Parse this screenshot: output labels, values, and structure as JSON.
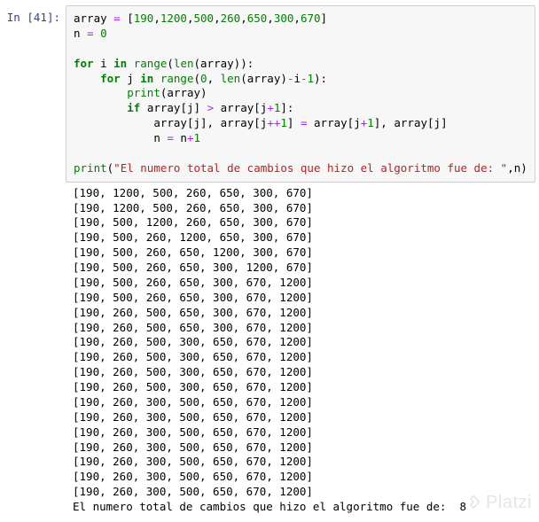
{
  "cell": {
    "prompt_prefix": "In [",
    "prompt_number": "41",
    "prompt_suffix": "]:",
    "code": {
      "l1_array": "array",
      "l1_eq": " = ",
      "l1_open": "[",
      "l1_n1": "190",
      "l1_c1": ",",
      "l1_n2": "1200",
      "l1_c2": ",",
      "l1_n3": "500",
      "l1_c3": ",",
      "l1_n4": "260",
      "l1_c4": ",",
      "l1_n5": "650",
      "l1_c5": ",",
      "l1_n6": "300",
      "l1_c6": ",",
      "l1_n7": "670",
      "l1_close": "]",
      "l2_n": "n",
      "l2_eq": " = ",
      "l2_zero": "0",
      "l4_for": "for",
      "l4_i": " i ",
      "l4_in": "in",
      "l4_sp": " ",
      "l4_range": "range",
      "l4_open": "(",
      "l4_len": "len",
      "l4_open2": "(",
      "l4_arr": "array",
      "l4_close2": ")",
      "l4_close": "):",
      "l5_indent": "    ",
      "l5_for": "for",
      "l5_j": " j ",
      "l5_in": "in",
      "l5_sp": " ",
      "l5_range": "range",
      "l5_open": "(",
      "l5_zero": "0",
      "l5_comma": ", ",
      "l5_len": "len",
      "l5_open2": "(",
      "l5_arr": "array",
      "l5_close2": ")",
      "l5_minus": "-",
      "l5_i": "i",
      "l5_m1": "-",
      "l5_one": "1",
      "l5_close": "):",
      "l6_indent": "        ",
      "l6_print": "print",
      "l6_open": "(",
      "l6_arr": "array",
      "l6_close": ")",
      "l7_indent": "        ",
      "l7_if": "if",
      "l7_sp": " ",
      "l7_arr1": "array",
      "l7_b1": "[",
      "l7_j1": "j",
      "l7_b1c": "]",
      "l7_gt": " > ",
      "l7_arr2": "array",
      "l7_b2": "[",
      "l7_j2": "j",
      "l7_plus": "+",
      "l7_one": "1",
      "l7_b2c": "]:",
      "l8_indent": "            ",
      "l8_arr1": "array",
      "l8_b1": "[",
      "l8_j1": "j",
      "l8_b1c": "],",
      "l8_sp1": " ",
      "l8_arr2": "array",
      "l8_b2": "[",
      "l8_j2": "j",
      "l8_pp": "++",
      "l8_one": "1",
      "l8_b2c": "]",
      "l8_eq": " = ",
      "l8_arr3": "array",
      "l8_b3": "[",
      "l8_j3": "j",
      "l8_p3": "+",
      "l8_one3": "1",
      "l8_b3c": "],",
      "l8_sp2": " ",
      "l8_arr4": "array",
      "l8_b4": "[",
      "l8_j4": "j",
      "l8_b4c": "]",
      "l9_indent": "            ",
      "l9_n": "n",
      "l9_eq": " = ",
      "l9_n2": "n",
      "l9_plus": "+",
      "l9_one": "1",
      "l11_print": "print",
      "l11_open": "(",
      "l11_str": "\"El numero total de cambios que hizo el algoritmo fue de: \"",
      "l11_comma": ",",
      "l11_n": "n",
      "l11_close": ")"
    }
  },
  "output": {
    "lines": [
      "[190, 1200, 500, 260, 650, 300, 670]",
      "[190, 1200, 500, 260, 650, 300, 670]",
      "[190, 500, 1200, 260, 650, 300, 670]",
      "[190, 500, 260, 1200, 650, 300, 670]",
      "[190, 500, 260, 650, 1200, 300, 670]",
      "[190, 500, 260, 650, 300, 1200, 670]",
      "[190, 500, 260, 650, 300, 670, 1200]",
      "[190, 500, 260, 650, 300, 670, 1200]",
      "[190, 260, 500, 650, 300, 670, 1200]",
      "[190, 260, 500, 650, 300, 670, 1200]",
      "[190, 260, 500, 300, 650, 670, 1200]",
      "[190, 260, 500, 300, 650, 670, 1200]",
      "[190, 260, 500, 300, 650, 670, 1200]",
      "[190, 260, 500, 300, 650, 670, 1200]",
      "[190, 260, 300, 500, 650, 670, 1200]",
      "[190, 260, 300, 500, 650, 670, 1200]",
      "[190, 260, 300, 500, 650, 670, 1200]",
      "[190, 260, 300, 500, 650, 670, 1200]",
      "[190, 260, 300, 500, 650, 670, 1200]",
      "[190, 260, 300, 500, 650, 670, 1200]",
      "[190, 260, 300, 500, 650, 670, 1200]"
    ],
    "final_line": "El numero total de cambios que hizo el algoritmo fue de:  8"
  },
  "watermark": {
    "text": "Platzi"
  }
}
